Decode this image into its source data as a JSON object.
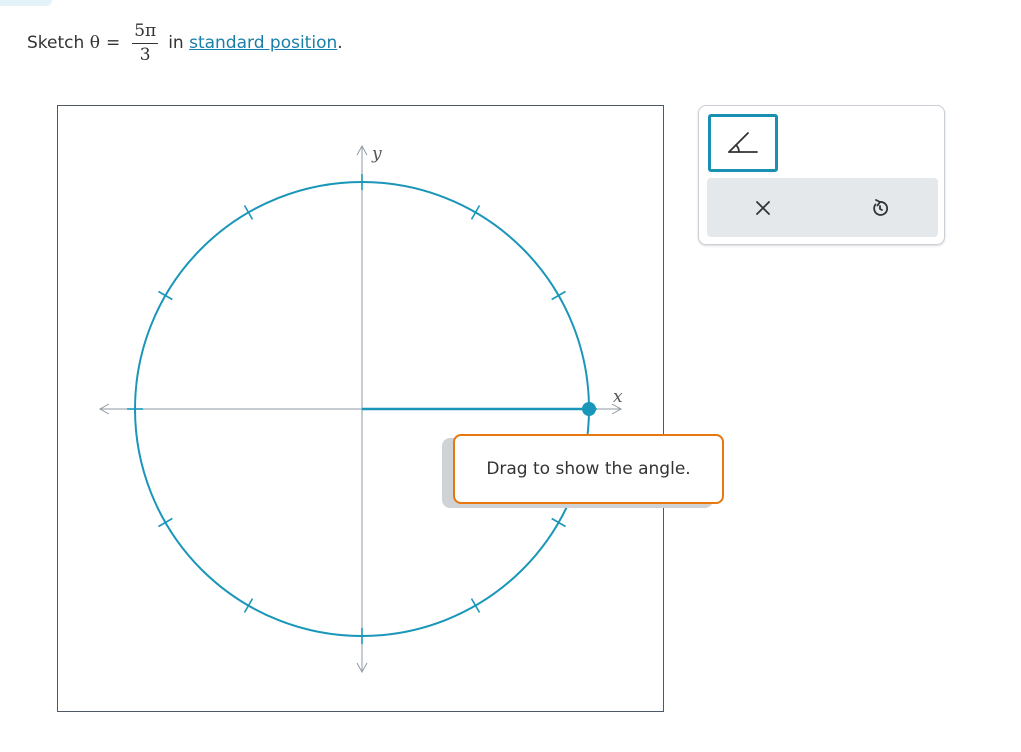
{
  "prompt": {
    "prefix": "Sketch",
    "variable": "θ",
    "equals": "=",
    "numerator": "5π",
    "denominator": "3",
    "middle": "in",
    "link_text": "standard position",
    "suffix": "."
  },
  "graph": {
    "x_label": "x",
    "y_label": "y",
    "circle_color": "#1a96b9",
    "axis_color": "#8d9aa5",
    "tick_count": 12
  },
  "tooltip": {
    "text": "Drag to show the angle.",
    "border_color": "#e8770f"
  },
  "toolbar": {
    "tool_icon": "angle-icon",
    "delete_icon": "close-icon",
    "reset_icon": "undo-icon",
    "accent_color": "#1a8fb4"
  }
}
